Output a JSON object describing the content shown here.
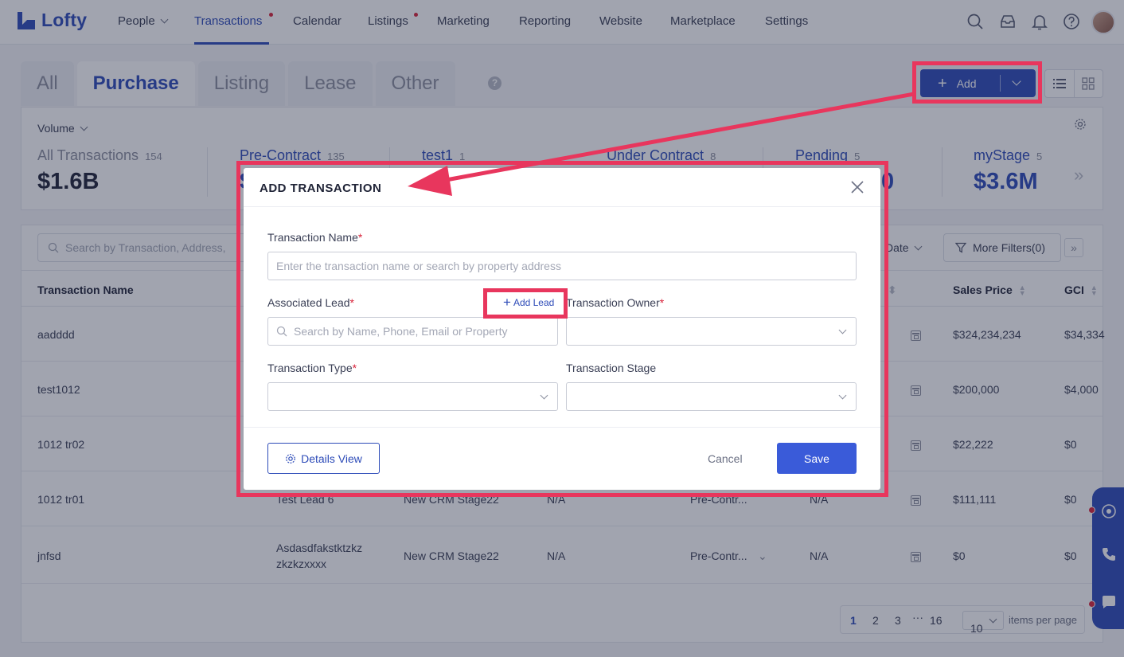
{
  "nav": {
    "logo_text": "Lofty",
    "items": [
      {
        "label": "People",
        "has_caret": true
      },
      {
        "label": "Transactions",
        "active": true,
        "dot": true
      },
      {
        "label": "Calendar"
      },
      {
        "label": "Listings",
        "dot": true
      },
      {
        "label": "Marketing"
      },
      {
        "label": "Reporting"
      },
      {
        "label": "Website"
      },
      {
        "label": "Marketplace"
      },
      {
        "label": "Settings"
      }
    ],
    "icons": [
      "search-icon",
      "inbox-icon",
      "bell-icon",
      "help-icon"
    ],
    "accent": "#2d4bb8"
  },
  "tabs": [
    {
      "label": "All"
    },
    {
      "label": "Purchase",
      "active": true
    },
    {
      "label": "Listing"
    },
    {
      "label": "Lease"
    },
    {
      "label": "Other"
    }
  ],
  "help_glyph": "?",
  "toolbar": {
    "add_label": "Add",
    "add_glyph": "+"
  },
  "stats": {
    "volume_label": "Volume",
    "items": [
      {
        "label": "All Transactions",
        "count": "154",
        "value": "$1.6B"
      },
      {
        "label": "Pre-Contract",
        "count": "135",
        "value": "$"
      },
      {
        "label": "test1",
        "count": "1",
        "value": ""
      },
      {
        "label": "Under Contract",
        "count": "8",
        "value": ""
      },
      {
        "label": "Pending",
        "count": "5",
        "value": "0"
      },
      {
        "label": "myStage",
        "count": "5",
        "value": "$3.6M"
      }
    ],
    "more_glyph": "»"
  },
  "table": {
    "search_placeholder": "Search by Transaction, Address,",
    "date_filter_label": "Date",
    "more_filters_label": "More Filters(0)",
    "expand_glyph": "»",
    "headers": {
      "name": "Transaction Name",
      "sales_price": "Sales Price",
      "gci": "GCI"
    },
    "rows": [
      {
        "name": "aadddd",
        "lead": "",
        "stage_crm": "",
        "col4": "",
        "stage": "",
        "col6": "",
        "sales_price": "$324,234,234",
        "gci": "$34,334"
      },
      {
        "name": "test1012",
        "lead": "",
        "stage_crm": "",
        "col4": "",
        "stage": "",
        "col6": "",
        "sales_price": "$200,000",
        "gci": "$4,000"
      },
      {
        "name": "1012 tr02",
        "lead": "",
        "stage_crm": "",
        "col4": "",
        "stage": "",
        "col6": "",
        "sales_price": "$22,222",
        "gci": "$0"
      },
      {
        "name": "1012 tr01",
        "lead": "Test Lead 6",
        "stage_crm": "New CRM Stage22",
        "col4": "N/A",
        "stage": "Pre-Contr...",
        "col6": "N/A",
        "sales_price": "$111,111",
        "gci": "$0"
      },
      {
        "name": "jnfsd",
        "lead": "Asdasdfakstktzkz",
        "lead2": "zkzkzxxxx",
        "stage_crm": "New CRM Stage22",
        "col4": "N/A",
        "stage": "Pre-Contr...",
        "col6": "N/A",
        "sales_price": "$0",
        "gci": "$0"
      }
    ],
    "pagination": {
      "pages": [
        "1",
        "2",
        "3",
        "···",
        "16"
      ],
      "page_size": "10",
      "per_page_label": "items per page"
    }
  },
  "modal": {
    "title": "ADD TRANSACTION",
    "transaction_name_label": "Transaction Name",
    "transaction_name_placeholder": "Enter the transaction name or search by property address",
    "associated_lead_label": "Associated Lead",
    "add_lead_label": "Add Lead",
    "lead_search_placeholder": "Search by Name, Phone, Email or Property",
    "transaction_owner_label": "Transaction Owner",
    "transaction_type_label": "Transaction Type",
    "transaction_stage_label": "Transaction Stage",
    "required_mark": "*",
    "details_view_label": "Details View",
    "cancel_label": "Cancel",
    "save_label": "Save",
    "save_color": "#3a5bd9"
  },
  "annotation_color": "#e8365d"
}
